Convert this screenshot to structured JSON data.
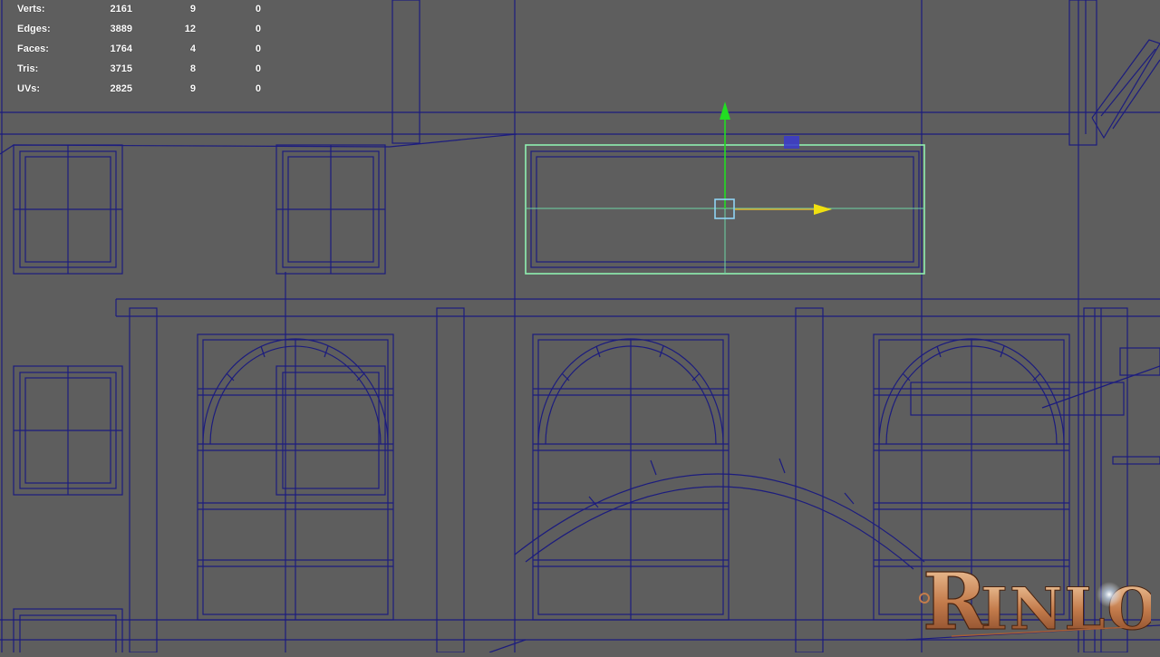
{
  "hud": {
    "rows": [
      {
        "label": "Verts:",
        "v1": "2161",
        "v2": "9",
        "v3": "0"
      },
      {
        "label": "Edges:",
        "v1": "3889",
        "v2": "12",
        "v3": "0"
      },
      {
        "label": "Faces:",
        "v1": "1764",
        "v2": "4",
        "v3": "0"
      },
      {
        "label": "Tris:",
        "v1": "3715",
        "v2": "8",
        "v3": "0"
      },
      {
        "label": "UVs:",
        "v1": "2825",
        "v2": "9",
        "v3": "0"
      }
    ]
  },
  "watermark": {
    "text": "RINLO"
  },
  "colors": {
    "background": "#5e5e5e",
    "wireframe": "#1c1c7e",
    "selection": "#8ff0b0",
    "axis_x": "#f0e010",
    "axis_y": "#22dd22",
    "axis_z_plane": "#3a3acc",
    "manipulator_center": "#8fd4f4",
    "hud_text": "#ffffff"
  }
}
